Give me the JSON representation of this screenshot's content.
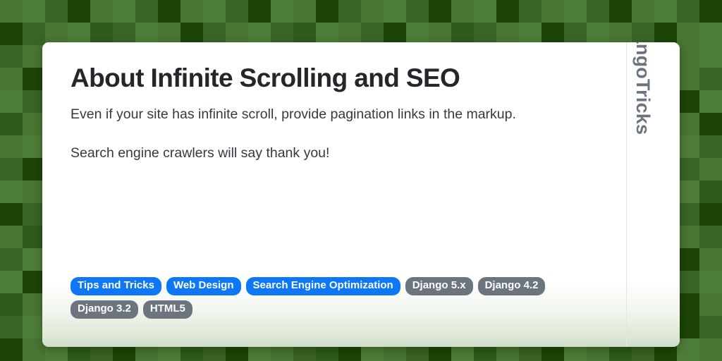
{
  "colors": {
    "tag_primary": "#0d77f7",
    "tag_muted": "#6c757d",
    "title_text": "#23272b",
    "body_text": "#343a40",
    "handle_text": "#6c757d",
    "card_background": "#ffffff",
    "card_fade": "#cfdcc8",
    "background_greens": [
      "#4a7533",
      "#4e7d38",
      "#3a6425",
      "#2e5a1c",
      "#1d4507",
      "#44702e"
    ]
  },
  "card": {
    "title": "About Infinite Scrolling and SEO",
    "paragraphs": [
      "Even if your site has infinite scroll, provide pagination links in the markup.",
      "Search engine crawlers will say thank you!"
    ],
    "tags": [
      {
        "label": "Tips and Tricks",
        "style": "primary"
      },
      {
        "label": "Web Design",
        "style": "primary"
      },
      {
        "label": "Search Engine Optimization",
        "style": "primary"
      },
      {
        "label": "Django 5.x",
        "style": "muted"
      },
      {
        "label": "Django 4.2",
        "style": "muted"
      },
      {
        "label": "Django 3.2",
        "style": "muted"
      },
      {
        "label": "HTML5",
        "style": "muted"
      }
    ]
  },
  "sidebar": {
    "handle": "@DjangoTricks"
  },
  "background": {
    "tile_size": 32,
    "columns": 32,
    "rows": 16,
    "tiles": [
      0,
      1,
      2,
      4,
      0,
      1,
      2,
      4,
      0,
      1,
      2,
      4,
      1,
      0,
      4,
      2,
      0,
      1,
      2,
      4,
      0,
      1,
      4,
      2,
      0,
      1,
      2,
      4,
      0,
      1,
      2,
      4,
      4,
      2,
      0,
      1,
      3,
      2,
      1,
      0,
      4,
      2,
      0,
      1,
      2,
      3,
      1,
      0,
      2,
      4,
      1,
      0,
      3,
      2,
      0,
      1,
      4,
      2,
      1,
      0,
      2,
      4,
      0,
      1,
      2,
      0,
      1,
      4,
      2,
      0,
      3,
      1,
      2,
      4,
      0,
      1,
      3,
      2,
      1,
      4,
      0,
      2,
      1,
      3,
      2,
      0,
      4,
      1,
      2,
      0,
      1,
      3,
      4,
      2,
      0,
      1,
      0,
      4,
      2,
      1,
      0,
      2,
      4,
      3,
      1,
      0,
      2,
      4,
      0,
      1,
      2,
      3,
      4,
      0,
      1,
      2,
      0,
      4,
      2,
      1,
      3,
      0,
      1,
      2,
      4,
      1,
      0,
      2,
      1,
      2,
      4,
      0,
      3,
      1,
      2,
      0,
      4,
      1,
      0,
      2,
      1,
      4,
      0,
      3,
      2,
      1,
      0,
      4,
      1,
      2,
      3,
      0,
      2,
      4,
      0,
      1,
      2,
      0,
      4,
      1,
      3,
      0,
      1,
      2,
      4,
      0,
      1,
      3,
      2,
      0,
      4,
      1,
      2,
      0,
      1,
      4,
      3,
      2,
      0,
      1,
      2,
      4,
      0,
      3,
      1,
      2,
      4,
      0,
      1,
      2,
      0,
      4,
      0,
      1,
      2,
      4,
      1,
      3,
      0,
      2,
      1,
      4,
      2,
      0,
      3,
      1,
      0,
      2,
      4,
      1,
      2,
      0,
      1,
      3,
      4,
      2,
      0,
      1,
      2,
      4,
      3,
      0,
      1,
      2,
      2,
      4,
      0,
      1,
      2,
      0,
      4,
      1,
      3,
      2,
      1,
      0,
      4,
      2,
      1,
      3,
      0,
      4,
      1,
      2,
      0,
      1,
      2,
      4,
      1,
      3,
      0,
      2,
      4,
      1,
      2,
      0,
      1,
      0,
      4,
      2,
      0,
      1,
      3,
      4,
      2,
      1,
      0,
      2,
      1,
      4,
      3,
      0,
      2,
      1,
      4,
      0,
      2,
      1,
      0,
      3,
      4,
      2,
      1,
      0,
      2,
      4,
      1,
      3,
      4,
      2,
      1,
      0,
      3,
      2,
      1,
      0,
      4,
      0,
      2,
      1,
      3,
      0,
      4,
      2,
      1,
      0,
      2,
      3,
      1,
      4,
      2,
      0,
      1,
      2,
      4,
      3,
      0,
      1,
      2,
      4,
      0,
      3,
      2,
      1,
      4,
      0,
      2,
      3,
      1,
      2,
      4,
      0,
      1,
      2,
      3,
      1,
      4,
      0,
      2,
      1,
      3,
      0,
      4,
      2,
      1,
      0,
      2,
      4,
      1,
      3,
      0,
      2,
      2,
      1,
      0,
      4,
      1,
      3,
      2,
      0,
      1,
      4,
      0,
      2,
      3,
      1,
      2,
      4,
      0,
      1,
      3,
      2,
      4,
      1,
      0,
      2,
      3,
      4,
      1,
      2,
      0,
      1,
      4,
      0,
      1,
      4,
      3,
      2,
      0,
      1,
      4,
      2,
      3,
      0,
      1,
      2,
      4,
      3,
      0,
      1,
      2,
      4,
      1,
      0,
      3,
      2,
      1,
      4,
      0,
      2,
      3,
      1,
      4,
      0,
      2,
      1,
      3,
      0,
      2,
      1,
      4,
      2,
      0,
      3,
      1,
      4,
      2,
      0,
      1,
      3,
      4,
      2,
      0,
      1,
      2,
      4,
      1,
      0,
      3,
      2,
      4,
      1,
      0,
      2,
      1,
      3,
      4,
      0,
      2,
      1,
      4,
      0,
      2,
      3,
      1,
      4,
      0,
      2,
      1,
      3,
      0,
      4,
      2,
      1,
      3,
      0,
      4,
      1,
      2,
      0,
      3,
      4,
      1,
      2,
      0,
      3,
      2,
      1,
      4,
      2,
      4,
      0,
      1,
      3,
      2,
      4,
      0,
      1,
      3,
      2,
      4,
      1,
      0,
      2,
      3,
      4,
      1,
      0,
      2,
      4,
      1,
      3,
      0,
      2,
      4,
      1,
      0,
      3,
      2,
      4,
      1,
      0
    ]
  }
}
